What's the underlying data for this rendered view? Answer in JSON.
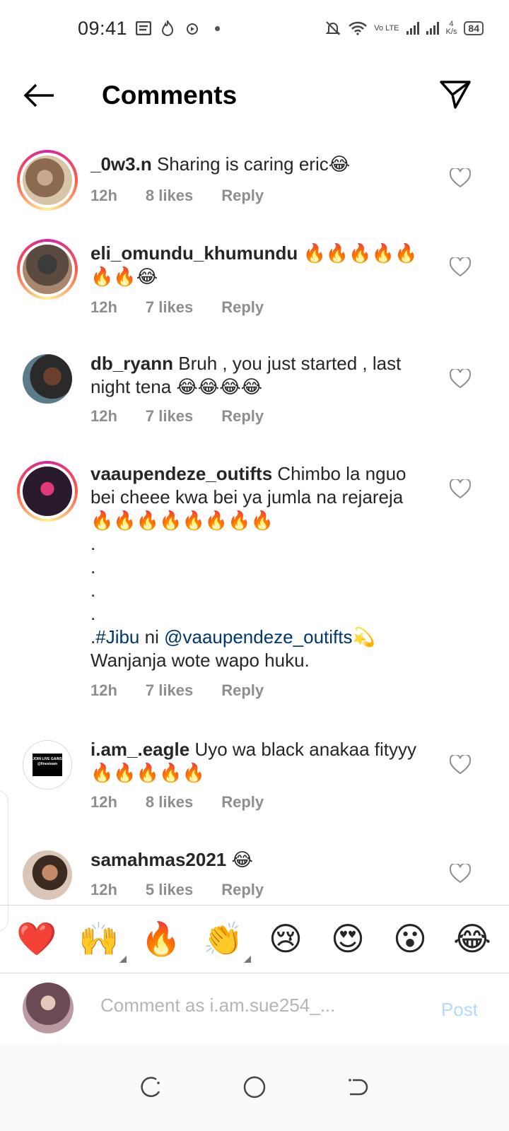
{
  "status_bar": {
    "time": "09:41",
    "network_speed_value": "4",
    "network_speed_unit": "K/s",
    "battery": "84",
    "lte_label": "Vo LTE"
  },
  "header": {
    "title": "Comments"
  },
  "comments": [
    {
      "username": "_0w3.n",
      "text": "Sharing is caring eric😂",
      "time": "12h",
      "likes": "8 likes",
      "reply": "Reply"
    },
    {
      "username": "eli_omundu_khumundu",
      "text": "🔥🔥🔥🔥🔥🔥🔥😂",
      "time": "12h",
      "likes": "7 likes",
      "reply": "Reply"
    },
    {
      "username": "db_ryann",
      "text": "Bruh , you just started , last night tena 😂😂😂😂",
      "time": "12h",
      "likes": "7 likes",
      "reply": "Reply"
    },
    {
      "username": "vaaupendeze_outifts",
      "text": "Chimbo la nguo bei cheee kwa bei ya jumla na rejareja 🔥🔥🔥🔥🔥🔥🔥🔥",
      "dots": ".\n.\n.\n.",
      "hashtag_prefix": ".",
      "hashtag": "#Jibu",
      "mid": "ni",
      "mention": "@vaaupendeze_outifts",
      "mention_emoji": "💫",
      "tail": "Wanjanja wote wapo huku.",
      "time": "12h",
      "likes": "7 likes",
      "reply": "Reply"
    },
    {
      "username": "i.am_.eagle",
      "text": "Uyo wa black anakaa fityyy 🔥🔥🔥🔥🔥",
      "avatar_text": "JOIN LIVE GAINS @finesteam",
      "time": "12h",
      "likes": "8 likes",
      "reply": "Reply"
    },
    {
      "username": "samahmas2021",
      "text": "😂",
      "time": "12h",
      "likes": "5 likes",
      "reply": "Reply"
    }
  ],
  "emoji_bar": [
    "❤️",
    "🙌",
    "🔥",
    "👏",
    "😢",
    "😍",
    "😮",
    "😂"
  ],
  "composer": {
    "placeholder": "Comment as i.am.sue254_...",
    "value": "",
    "post_label": "Post"
  },
  "colors": {
    "accent_blue_disabled": "#b3dbff",
    "hashtag": "#00376b",
    "meta_gray": "#8e8e8e"
  }
}
